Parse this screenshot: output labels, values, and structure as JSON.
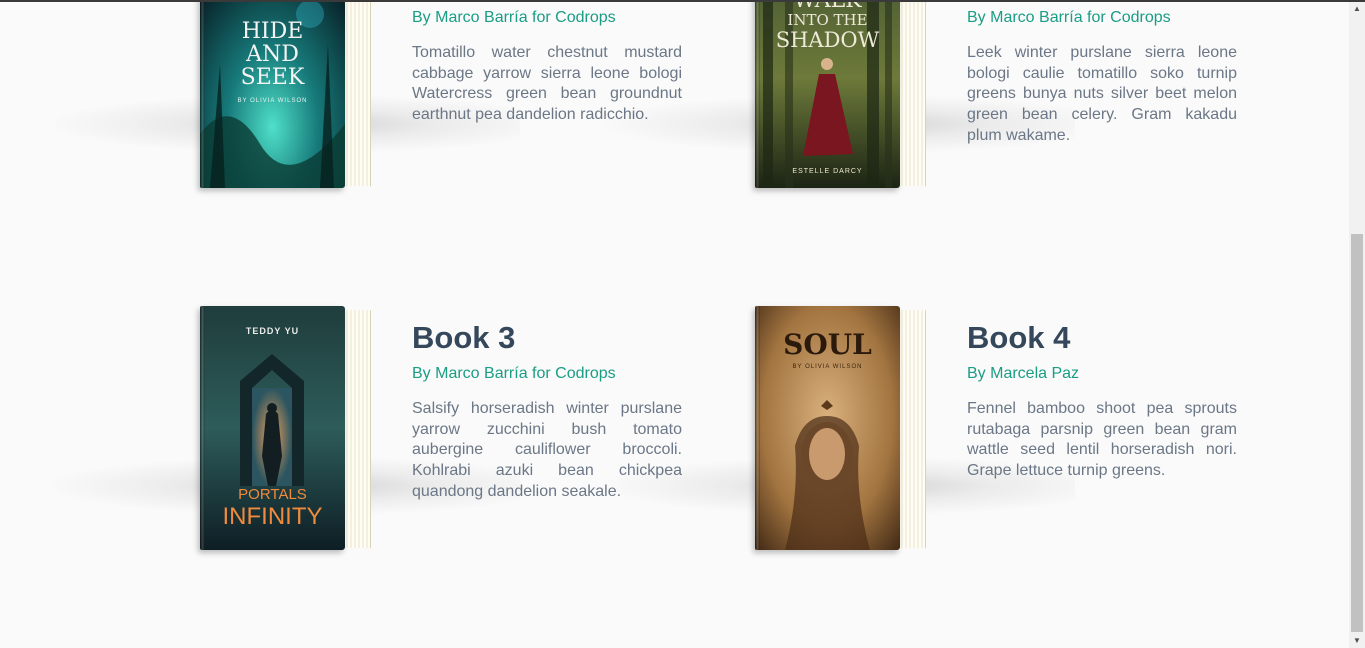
{
  "books": [
    {
      "title": "",
      "author": "By Marco Barría for Codrops",
      "description": "Tomatillo water chestnut mustard cabbage yarrow sierra leone bologi Watercress green bean groundnut earthnut pea dandelion radicchio.",
      "cover": {
        "title_lines": [
          "HIDE",
          "AND",
          "SEEK"
        ],
        "author": "BY OLIVIA WILSON",
        "color": "#1b6e72"
      }
    },
    {
      "title": "",
      "author": "By Marco Barría for Codrops",
      "description": "Leek winter purslane sierra leone bologi caulie tomatillo soko turnip greens bunya nuts silver beet melon green bean celery. Gram kakadu plum wakame.",
      "cover": {
        "title_lines": [
          "WALK",
          "INTO THE",
          "SHADOW"
        ],
        "author": "ESTELLE DARCY",
        "color": "#2b3a1f"
      }
    },
    {
      "title": "Book 3",
      "author": "By Marco Barría for Codrops",
      "description": "Salsify horseradish winter purslane yarrow zucchini bush tomato aubergine cauliflower broccoli. Kohlrabi azuki bean chickpea quandong dandelion seakale.",
      "cover": {
        "title_lines": [
          "PORTALS",
          "INFINITY"
        ],
        "author": "TEDDY YU",
        "color": "#1c3a44"
      }
    },
    {
      "title": "Book 4",
      "author": "By Marcela Paz",
      "description": "Fennel bamboo shoot pea sprouts rutabaga parsnip green bean gram wattle seed lentil horseradish nori. Grape lettuce turnip greens.",
      "cover": {
        "title_lines": [
          "SOUL"
        ],
        "author": "BY OLIVIA WILSON",
        "color": "#a9804f"
      }
    }
  ],
  "colors": {
    "title": "#34475b",
    "accent": "#1a9d84",
    "text": "#6b7786",
    "background": "#fafafa"
  },
  "scrollbar": {
    "up_icon": "triangle-up-icon",
    "down_icon": "triangle-down-icon"
  }
}
